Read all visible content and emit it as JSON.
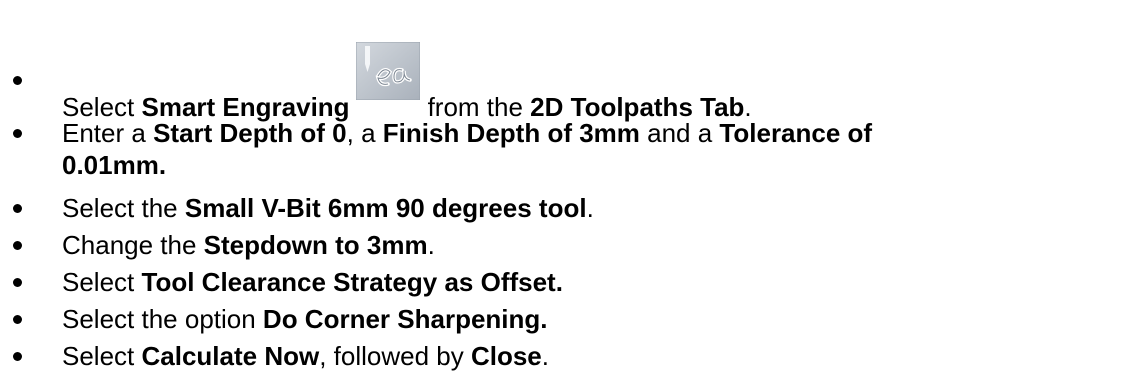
{
  "steps": [
    {
      "parts": {
        "p1": "Select ",
        "p2": "Smart Engraving",
        "icon": "smart-engraving-toolpath-icon",
        "p3": "from the ",
        "p4": "2D Toolpaths Tab",
        "p5": "."
      }
    },
    {
      "parts": {
        "p1": "Enter a ",
        "p2": "Start Depth of 0",
        "p3": ", a ",
        "p4": "Finish Depth of 3mm",
        "p5": " and a ",
        "p6": "Tolerance of",
        "p7": "0.01mm."
      }
    },
    {
      "parts": {
        "p1": "Select the ",
        "p2": "Small V-Bit 6mm 90 degrees tool",
        "p3": "."
      }
    },
    {
      "parts": {
        "p1": "Change the ",
        "p2": "Stepdown to 3mm",
        "p3": "."
      }
    },
    {
      "parts": {
        "p1": "Select ",
        "p2": "Tool Clearance Strategy as Offset."
      }
    },
    {
      "parts": {
        "p1": "Select the option ",
        "p2": "Do Corner Sharpening."
      }
    },
    {
      "parts": {
        "p1": "Select ",
        "p2": "Calculate Now",
        "p3": ", followed by ",
        "p4": "Close",
        "p5": "."
      }
    }
  ],
  "icon_glyph_text": "ea",
  "colors": {
    "text": "#000000",
    "icon_bg": "#b9c0c8",
    "icon_glyph": "#ffffff"
  }
}
